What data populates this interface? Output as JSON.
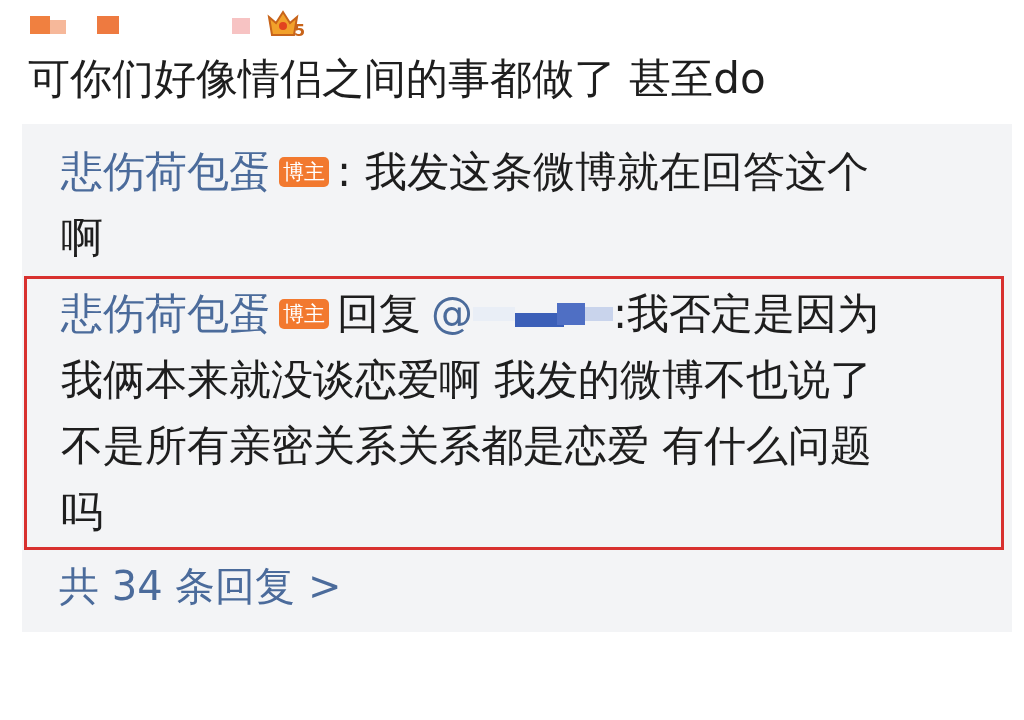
{
  "comment": {
    "level_badge": "5",
    "text": "可你们好像情侣之间的事都做了 甚至do"
  },
  "replies": [
    {
      "author": "悲伤荷包蛋",
      "badge": "博主",
      "text": ": 我发这条微博就在回答这个",
      "text_continued": "啊",
      "highlighted": false
    },
    {
      "author": "悲伤荷包蛋",
      "badge": "博主",
      "reply_word": "回复",
      "at": "@",
      "text": ":我否定是因为",
      "text_continued": "我俩本来就没谈恋爱啊 我发的微博不也说了不是所有亲密关系关系都是恋爱 有什么问题吗",
      "highlighted": true
    }
  ],
  "more_replies": "共 34 条回复 >"
}
